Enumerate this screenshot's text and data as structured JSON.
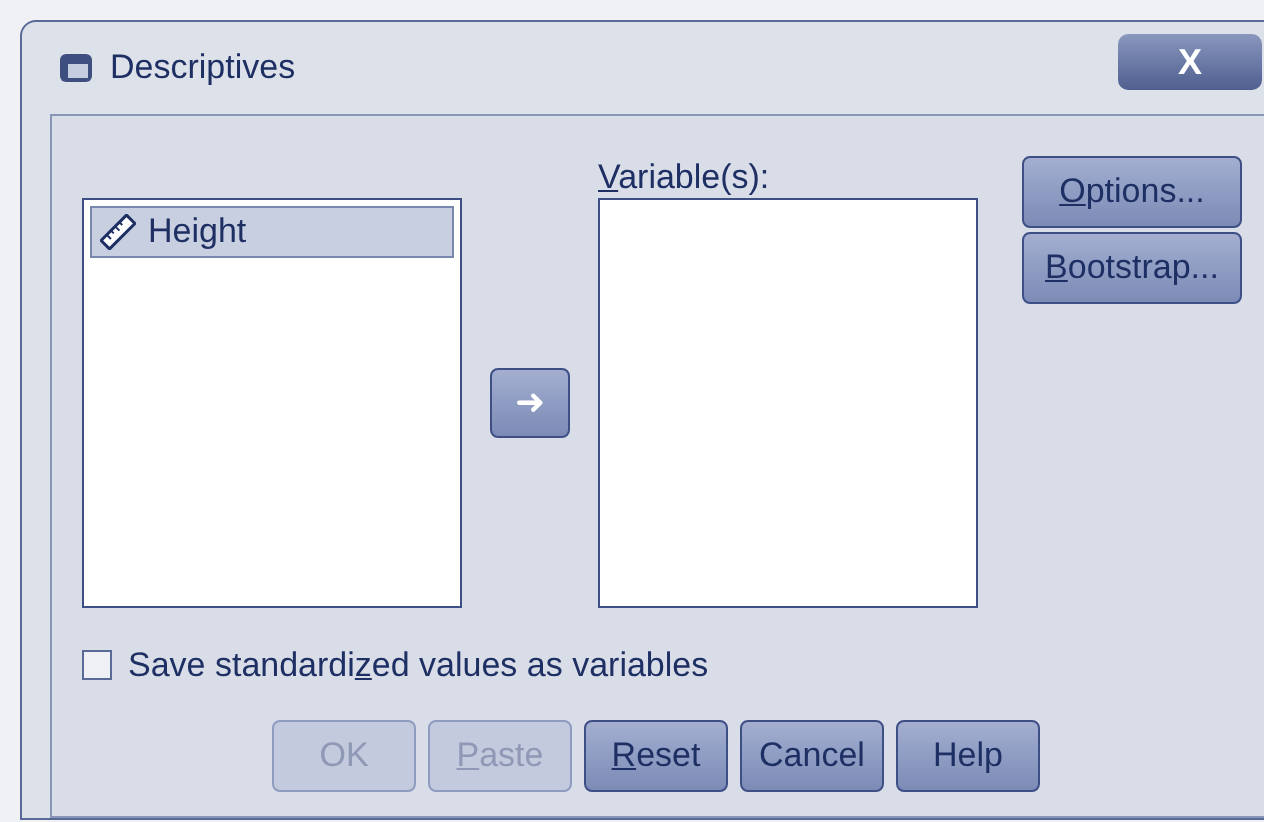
{
  "window": {
    "title": "Descriptives",
    "close": "X"
  },
  "source_list": {
    "items": [
      {
        "label": "Height",
        "selected": true
      }
    ]
  },
  "move_button": {
    "label": "➜"
  },
  "target_list": {
    "label": {
      "key": "V",
      "post": "ariable(s):"
    }
  },
  "side_buttons": [
    {
      "label": {
        "key": "O",
        "post": "ptions..."
      }
    },
    {
      "label": {
        "key": "B",
        "post": "ootstrap..."
      }
    }
  ],
  "save_option": {
    "label": {
      "pre": "Save standardi",
      "key": "z",
      "post": "ed values as variables"
    },
    "checked": false
  },
  "buttons": [
    {
      "label": {
        "pre": "OK"
      },
      "disabled": true
    },
    {
      "label": {
        "key": "P",
        "post": "aste"
      },
      "disabled": true
    },
    {
      "label": {
        "key": "R",
        "post": "eset"
      },
      "disabled": false
    },
    {
      "label": {
        "pre": "Cancel"
      },
      "disabled": false
    },
    {
      "label": {
        "pre": "Help"
      },
      "disabled": false
    }
  ]
}
